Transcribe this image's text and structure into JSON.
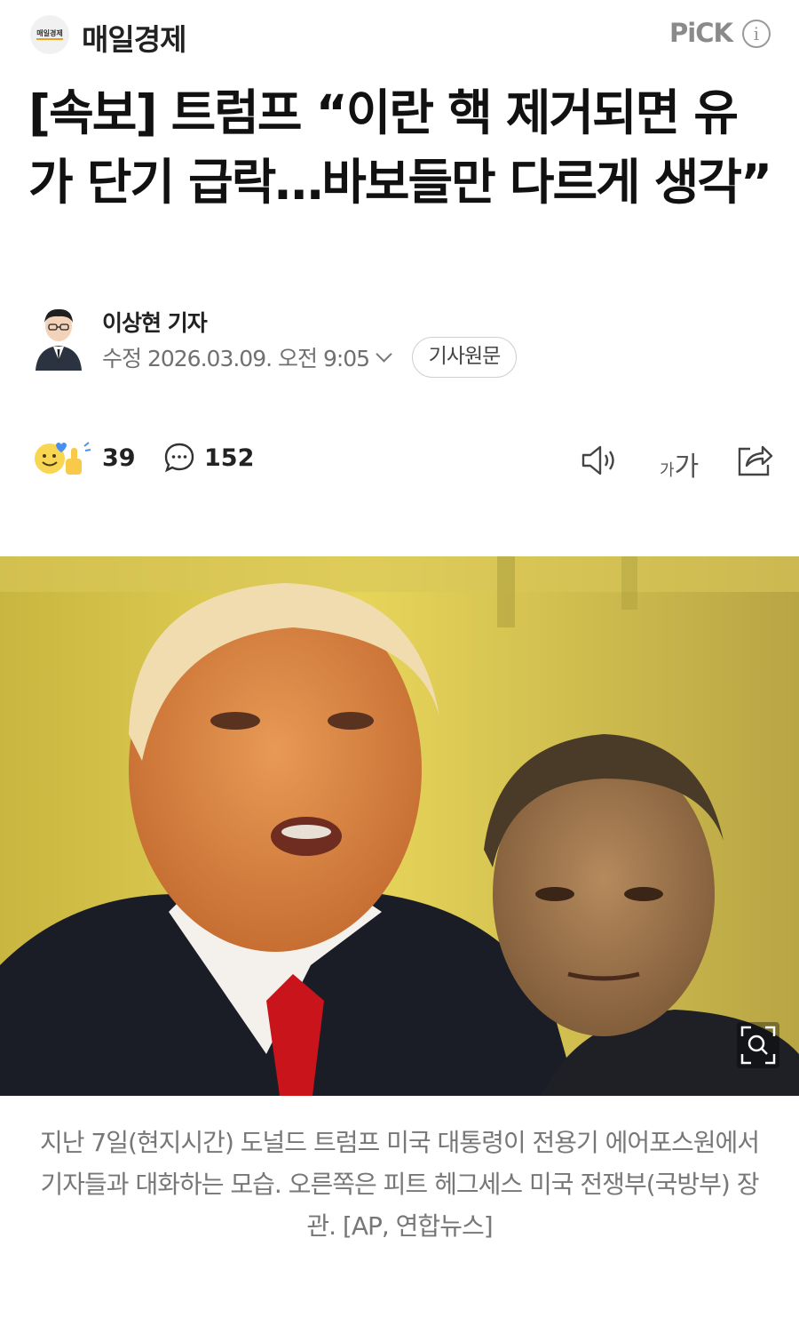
{
  "header": {
    "press_logo_text": "매일경제",
    "press_name": "매일경제",
    "pick_label": "PiCK",
    "info_icon": "info-icon"
  },
  "article": {
    "title": "[속보] 트럼프 “이란 핵 제거되면 유가 단기 급락…바보들만 다르게 생각”",
    "reporter": "이상현 기자",
    "edited_label": "수정",
    "edited_time": "2026.03.09. 오전 9:05",
    "original_button": "기사원문",
    "photo_caption": "지난 7일(현지시간) 도널드 트럼프 미국 대통령이 전용기 에어포스원에서 기자들과 대화하는 모습. 오른쪽은 피트 헤그세스 미국 전쟁부(국방부) 장관. [AP, 연합뉴스]"
  },
  "actions": {
    "reaction_count": "39",
    "comment_count": "152",
    "font_size_small": "가",
    "font_size_large": "가"
  },
  "icons": [
    "reaction-icon",
    "comment-icon",
    "speaker-icon",
    "font-size-icon",
    "share-icon",
    "zoom-icon",
    "chevron-down-icon"
  ],
  "colors": {
    "accent_gold": "#e7a020",
    "meta_gray": "#707070",
    "caption_gray": "#777777"
  }
}
